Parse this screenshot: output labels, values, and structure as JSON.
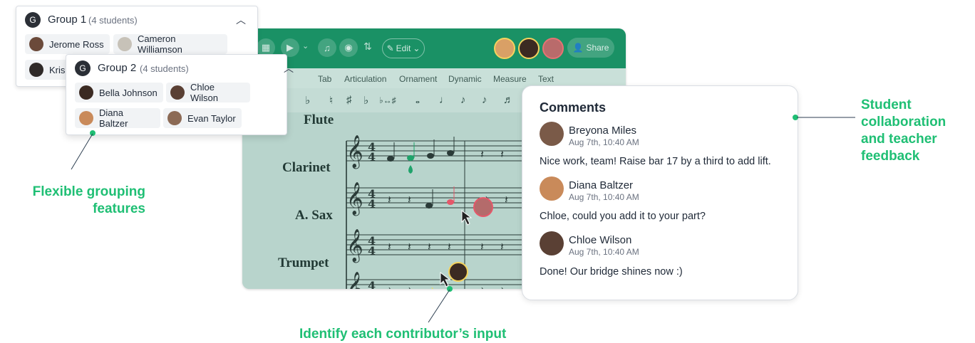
{
  "editor": {
    "toolbar": {
      "edit_label": "Edit",
      "share_label": "Share"
    },
    "menu": [
      "Tab",
      "Articulation",
      "Ornament",
      "Dynamic",
      "Measure",
      "Text"
    ],
    "instruments": [
      "Flute",
      "Clarinet",
      "A. Sax",
      "Trumpet"
    ]
  },
  "comments": {
    "title": "Comments",
    "entries": [
      {
        "name": "Breyona Miles",
        "time": "Aug 7th, 10:40 AM",
        "message": "Nice work, team! Raise bar 17 by a third to add lift."
      },
      {
        "name": "Diana Baltzer",
        "time": "Aug 7th, 10:40 AM",
        "message": "Chloe, could you add it to your part?"
      },
      {
        "name": "Chloe Wilson",
        "time": "Aug 7th, 10:40 AM",
        "message": "Done! Our bridge shines now :)"
      }
    ]
  },
  "groups": [
    {
      "badge": "G",
      "name": "Group 1",
      "count": "(4 students)",
      "members": [
        "Jerome Ross",
        "Cameron Williamson",
        "Kris"
      ]
    },
    {
      "badge": "G",
      "name": "Group 2",
      "count": "(4 students)",
      "members": [
        "Bella Johnson",
        "Chloe Wilson",
        "Diana Baltzer",
        "Evan Taylor"
      ]
    }
  ],
  "callouts": {
    "grouping_line1": "Flexible grouping",
    "grouping_line2": "features",
    "contributor": "Identify each contributor’s input",
    "collab_line1": "Student",
    "collab_line2": "collaboration",
    "collab_line3": "and teacher",
    "collab_line4": "feedback"
  },
  "colors": {
    "accent_green": "#1fbf74",
    "toolbar_green": "#1a9165",
    "score_bg": "#b8d4cc"
  }
}
